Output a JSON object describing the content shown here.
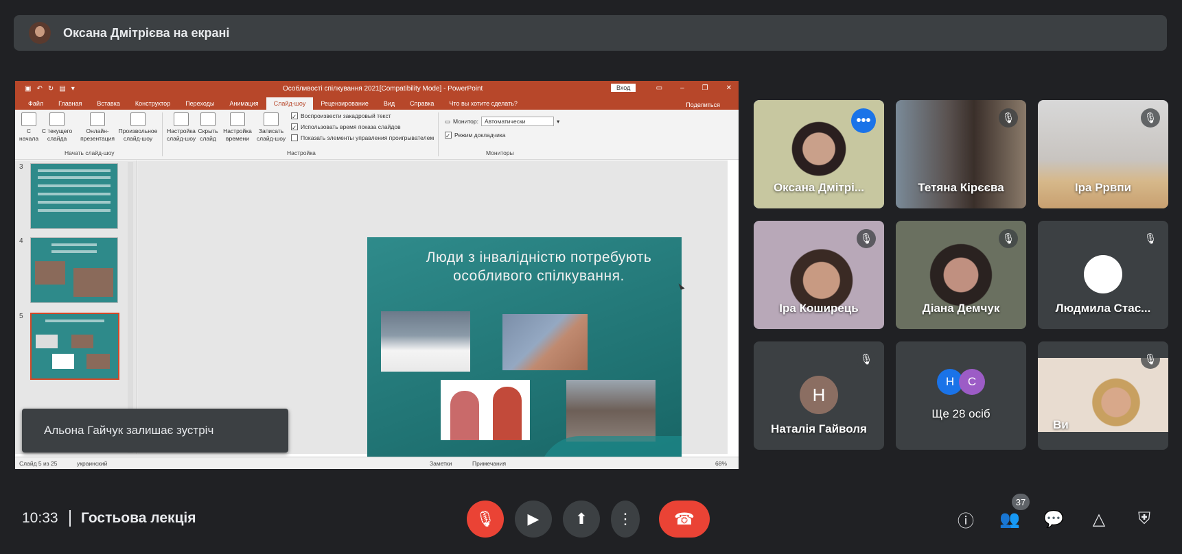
{
  "header": {
    "presenter_text": "Оксана Дмітрієва на екрані"
  },
  "powerpoint": {
    "window_title": "Особливості спілкування 2021[Compatibility Mode] - PowerPoint",
    "login_button": "Вход",
    "tabs": [
      "Файл",
      "Главная",
      "Вставка",
      "Конструктор",
      "Переходы",
      "Анимация",
      "Слайд-шоу",
      "Рецензирование",
      "Вид",
      "Справка",
      "Что вы хотите сделать?"
    ],
    "active_tab": "Слайд-шоу",
    "share": "Поделиться",
    "ribbon": {
      "from_start": "С\nначала",
      "from_current": "С текущего\nслайда",
      "online": "Онлайн-\nпрезентация",
      "custom": "Произвольное\nслайд-шоу",
      "group_start": "Начать слайд-шоу",
      "setup": "Настройка\nслайд-шоу",
      "hide": "Скрыть\nслайд",
      "rehearse": "Настройка\nвремени",
      "record": "Записать\nслайд-шоу",
      "chk_narration": "Воспроизвести закадровый текст",
      "chk_timings": "Использовать время показа слайдов",
      "chk_controls": "Показать элементы управления проигрывателем",
      "group_setup": "Настройка",
      "monitor_label": "Монитор:",
      "monitor_value": "Автоматически",
      "presenter_view": "Режим докладчика",
      "group_monitors": "Мониторы"
    },
    "thumbnails": [
      "3",
      "4",
      "5"
    ],
    "slide_title": "Люди з інвалідністю потребують особливого спілкування.",
    "status": {
      "slide_of": "Слайд 5 из 25",
      "language": "украинский",
      "notes": "Заметки",
      "comments": "Примечания",
      "zoom": "68%"
    }
  },
  "toast": {
    "text": "Альона Гайчук залишає зустріч"
  },
  "participants": [
    {
      "name": "Оксана Дмітрі...",
      "type": "video",
      "active": true
    },
    {
      "name": "Тетяна Кірєєва",
      "type": "video"
    },
    {
      "name": "Іра Ррвпи",
      "type": "video"
    },
    {
      "name": "Іра Коширець",
      "type": "video"
    },
    {
      "name": "Діана Демчук",
      "type": "video"
    },
    {
      "name": "Людмила Стас...",
      "type": "avatar"
    },
    {
      "name": "Наталія Гайволя",
      "type": "letter",
      "letter": "Н"
    },
    {
      "name": "Ще 28 осіб",
      "type": "group",
      "letters": [
        "Н",
        "С"
      ]
    },
    {
      "name": "Ви",
      "type": "video"
    }
  ],
  "bottom": {
    "time": "10:33",
    "meeting": "Гостьова лекція",
    "participants_count": "37"
  },
  "colors": {
    "hangup": "#ea4335",
    "bg": "#202124",
    "tile": "#3c4043",
    "pp_accent": "#b7472a"
  }
}
